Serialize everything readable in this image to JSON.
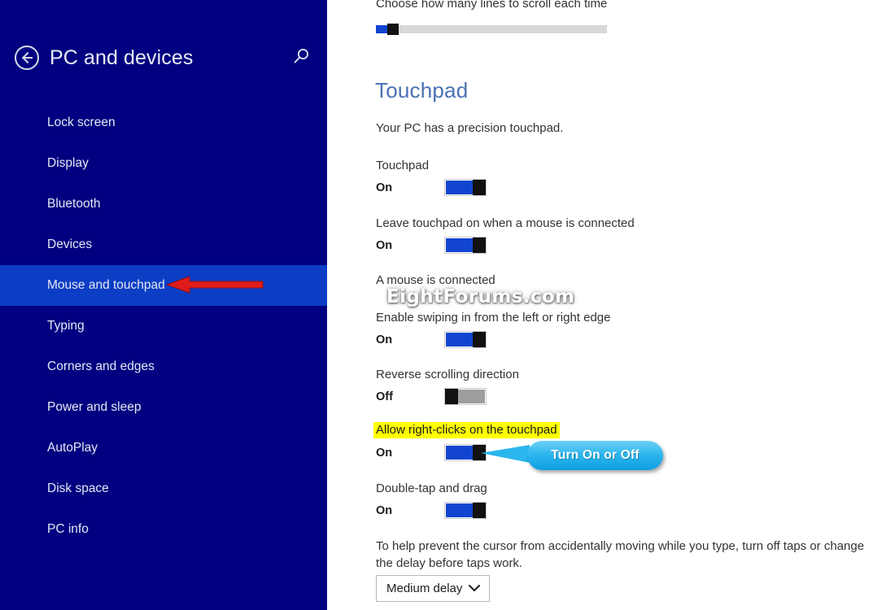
{
  "sidebar": {
    "back_icon": "back-arrow-icon",
    "title": "PC and devices",
    "search_icon": "search-icon",
    "items": [
      {
        "label": "Lock screen",
        "selected": false
      },
      {
        "label": "Display",
        "selected": false
      },
      {
        "label": "Bluetooth",
        "selected": false
      },
      {
        "label": "Devices",
        "selected": false
      },
      {
        "label": "Mouse and touchpad",
        "selected": true
      },
      {
        "label": "Typing",
        "selected": false
      },
      {
        "label": "Corners and edges",
        "selected": false
      },
      {
        "label": "Power and sleep",
        "selected": false
      },
      {
        "label": "AutoPlay",
        "selected": false
      },
      {
        "label": "Disk space",
        "selected": false
      },
      {
        "label": "PC info",
        "selected": false
      }
    ]
  },
  "content": {
    "scroll_caption": "Choose how many lines to scroll each time",
    "heading": "Touchpad",
    "subtitle": "Your PC has a precision touchpad.",
    "settings": [
      {
        "label": "Touchpad",
        "state": "On",
        "on": true,
        "highlight": false
      },
      {
        "label": "Leave touchpad on when a mouse is connected",
        "state": "On",
        "on": true,
        "highlight": false
      },
      {
        "label": "A mouse is connected",
        "state": "",
        "on": null,
        "highlight": false
      },
      {
        "label": "Enable swiping in from the left or right edge",
        "state": "On",
        "on": true,
        "highlight": false
      },
      {
        "label": "Reverse scrolling direction",
        "state": "Off",
        "on": false,
        "highlight": false
      },
      {
        "label": "Allow right-clicks on the touchpad",
        "state": "On",
        "on": true,
        "highlight": true
      },
      {
        "label": "Double-tap and drag",
        "state": "On",
        "on": true,
        "highlight": false
      }
    ],
    "note": "To help prevent the cursor from accidentally moving while you type, turn off taps or change the delay before taps work.",
    "delay_select": {
      "value": "Medium delay",
      "chevron_icon": "chevron-down-icon"
    }
  },
  "annotations": {
    "watermark": "EightForums.com",
    "callout_text": "Turn On or Off",
    "arrow_icon": "red-arrow-left-icon",
    "highlight_color": "#ffff00",
    "callout_color": "#2bb6ee",
    "arrow_color": "#e01b1b"
  }
}
